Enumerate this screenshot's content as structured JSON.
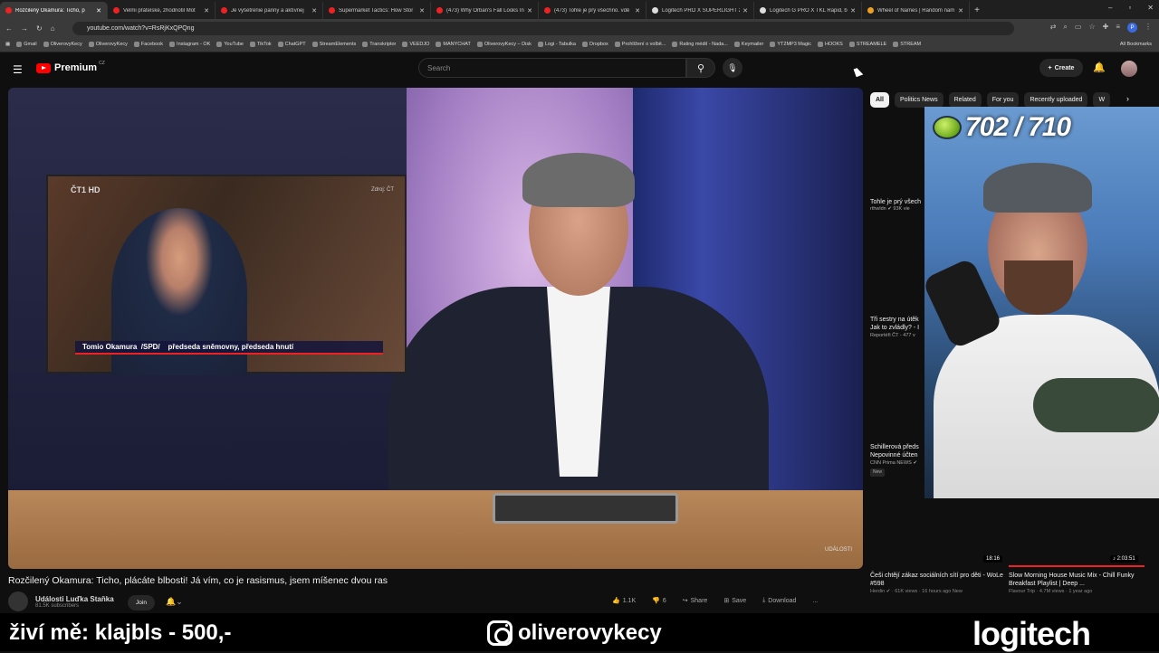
{
  "browser": {
    "tabs": [
      {
        "title": "Rozčilený Okamura: Ticho, p",
        "active": true
      },
      {
        "title": "Velmi přátelské, zhodnotil Mot",
        "active": false
      },
      {
        "title": "Je vyšetrenie panny a aktívnej",
        "active": false
      },
      {
        "title": "Supermarket Tactics: How Stor",
        "active": false
      },
      {
        "title": "(473) Why Orban's Fall Looks In",
        "active": false
      },
      {
        "title": "(473) Tohle je prý všechno. vdě",
        "active": false
      },
      {
        "title": "Logitech PRO X SUPERLIGHT 2",
        "active": false
      },
      {
        "title": "Logitech G PRO X TKL Rapid, bi",
        "active": false
      },
      {
        "title": "Wheel of Names | Random nam",
        "active": false
      }
    ],
    "new_tab": "+",
    "url": "youtube.com/watch?v=RsRjKxQPQng",
    "profile_initial": "P",
    "bookmarks": [
      "Gmail",
      "OliverovyKecy",
      "OliverovyKecy",
      "Facebook",
      "Instagram - OK",
      "YouTube",
      "TikTok",
      "ChatGPT",
      "StreamElements",
      "Transkriptor",
      "VEEDJO",
      "MANYCHAT",
      "OliverovyKecy – Disk",
      "Logi - Tabulka",
      "Dropbox",
      "Prohlížení o volbě...",
      "Rating médií - Nada...",
      "Keymailer",
      "YT2MP3 Magic",
      "HOOKS",
      "STREAMELE",
      "STREAM"
    ],
    "all_bookmarks": "All Bookmarks"
  },
  "youtube": {
    "brand": "Premium",
    "region": "CZ",
    "search_placeholder": "Search",
    "create_label": "Create",
    "video": {
      "title": "Rozčilený Okamura: Ticho, plácáte blbosti! Já vím, co je rasismus, jsem míšenec dvou ras",
      "channel": "Události Luďka Staňka",
      "subscribers": "81.5K subscribers",
      "join": "Join",
      "likes": "1.1K",
      "dislikes": "6",
      "share": "Share",
      "save": "Save",
      "download": "Download",
      "more": "...",
      "inset_network": "ČT1 HD",
      "inset_source": "Zdroj: ČT",
      "caption": "Tomio Okamura  /SPD/    předseda sněmovny, předseda hnutí",
      "watermark": "UDÁLOSTI"
    },
    "chips": [
      "All",
      "Politics News",
      "Related",
      "For you",
      "Recently uploaded",
      "W"
    ],
    "recommendations": [
      {
        "title": "Tohle je prý všech",
        "meta": "rthwldn ✔ 93K vie"
      },
      {
        "title": "Tři sestry na útěk Jak to zvládly? - I",
        "meta": "Reportéři ČT - 477 v"
      },
      {
        "title": "Schillerová předs Nepovinné účten",
        "meta": "CNN Prima NEWS ✔",
        "badge": "New"
      }
    ],
    "thumb_durations": [
      "18:16",
      "♪ 2:03:51"
    ],
    "cards": [
      {
        "title": "Češi chtějí zákaz sociálních sítí pro děti - WoLe #598",
        "meta": "Herdin ✔ · 61K views · 16 hours ago",
        "badge": "New"
      },
      {
        "title": "Slow Morning House Music Mix - Chill Funky Breakfast Playlist | Deep ...",
        "meta": "Flavour Trip · 4.7M views · 1 year ago"
      }
    ]
  },
  "stream_overlay": {
    "score": "702 / 710",
    "tip_text": "živí mě: klajbls - 500,-",
    "instagram": "oliverovykecy",
    "sponsor": "logitech"
  },
  "colors": {
    "yt_red": "#ff0000",
    "background": "#0f0f0f"
  }
}
